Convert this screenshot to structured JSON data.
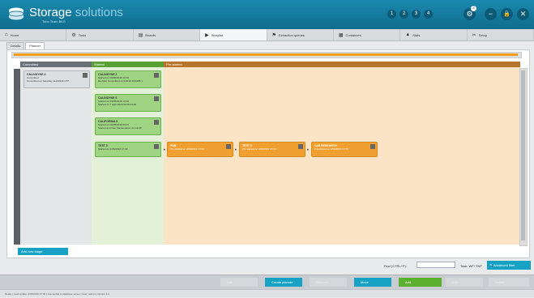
{
  "header": {
    "title": "Storage",
    "title_brand": "solutions",
    "subtitle": "Tobo Team BKS",
    "steps": [
      "1",
      "2",
      "3",
      "4"
    ],
    "notif_count": "2",
    "buttons": {
      "settings": "⚙",
      "minimize": "−",
      "lock": "🔒",
      "close": "✕"
    }
  },
  "menu": [
    {
      "label": "Home",
      "icon": "home-icon",
      "glyph": "⌂"
    },
    {
      "label": "Tools",
      "icon": "gear-icon",
      "glyph": "⚙"
    },
    {
      "label": "Boards",
      "icon": "board-icon",
      "glyph": "▤"
    },
    {
      "label": "Storylist",
      "icon": "play-icon",
      "glyph": "▶"
    },
    {
      "label": "Extraction queues",
      "icon": "filter-icon",
      "glyph": "⚑"
    },
    {
      "label": "Containers",
      "icon": "container-icon",
      "glyph": "▦"
    },
    {
      "label": "Stats",
      "icon": "chart-icon",
      "glyph": "▲"
    },
    {
      "label": "Setup",
      "icon": "wrench-icon",
      "glyph": "✂"
    }
  ],
  "subtabs": [
    "Details",
    "Planner"
  ],
  "columns": [
    {
      "label": "Committed",
      "color": "#6b7076"
    },
    {
      "label": "Started",
      "color": "#5aa135"
    },
    {
      "label": "Pre-started",
      "color": "#b8742a"
    }
  ],
  "lane_label": "Process milestone 4",
  "cards": [
    {
      "title": "CALINDYNE 4",
      "lines": [
        "Committed",
        "Committed on Saturday 11/2/2016 4:57"
      ],
      "style": "grey"
    },
    {
      "title": "CALINDYNE 3",
      "lines": [
        "Started on 09/05/2016 12:16",
        "Re-Start Committed on 6/2016 09/1988 1"
      ],
      "style": "green"
    },
    {
      "title": "CALINDYNE 5",
      "lines": [
        "Started on 09/05/2016 12:16",
        "Started on 7 April 2016 09:08 13:00"
      ],
      "style": "green"
    },
    {
      "title": "CALIFORNIA 6",
      "lines": [
        "Started on 09/05/2016 09:07",
        "Started and then Maintenance 4.2 12:28"
      ],
      "style": "green"
    },
    {
      "title": "TEST 5",
      "lines": [
        "Started on 2/06/2016 17:00"
      ],
      "style": "green"
    },
    {
      "title": "PDB",
      "lines": [
        "Pre-started on 2/06/2016 17:00"
      ],
      "style": "orange"
    },
    {
      "title": "TEST 6",
      "lines": [
        "Pre-started on 2/06/2016 17:00"
      ],
      "style": "orange"
    },
    {
      "title": "LAB RESEARCH",
      "lines": [
        "Pre-started on 2/06/2016 17:00"
      ],
      "style": "orange"
    }
  ],
  "stage_button": "Add new stage",
  "find": {
    "label": "Find (CTRL+F):",
    "value": "",
    "task_label": "Task: WF+TKP"
  },
  "advanced_button": "Advanced filter",
  "bottom_buttons": [
    {
      "label": "Add",
      "style": "disabled"
    },
    {
      "label": "Create planner",
      "style": "teal"
    },
    {
      "label": "Remove",
      "style": "disabled"
    },
    {
      "label": "Move",
      "style": "teal"
    },
    {
      "label": "Add",
      "style": "green"
    },
    {
      "label": "Edit",
      "style": "disabled"
    },
    {
      "label": "Delete",
      "style": "disabled"
    }
  ],
  "status_text": "Ready  |  Last update: 2/06/2016 17:00  |  Connected to database server  |  User: admin  |  Version 4.2"
}
